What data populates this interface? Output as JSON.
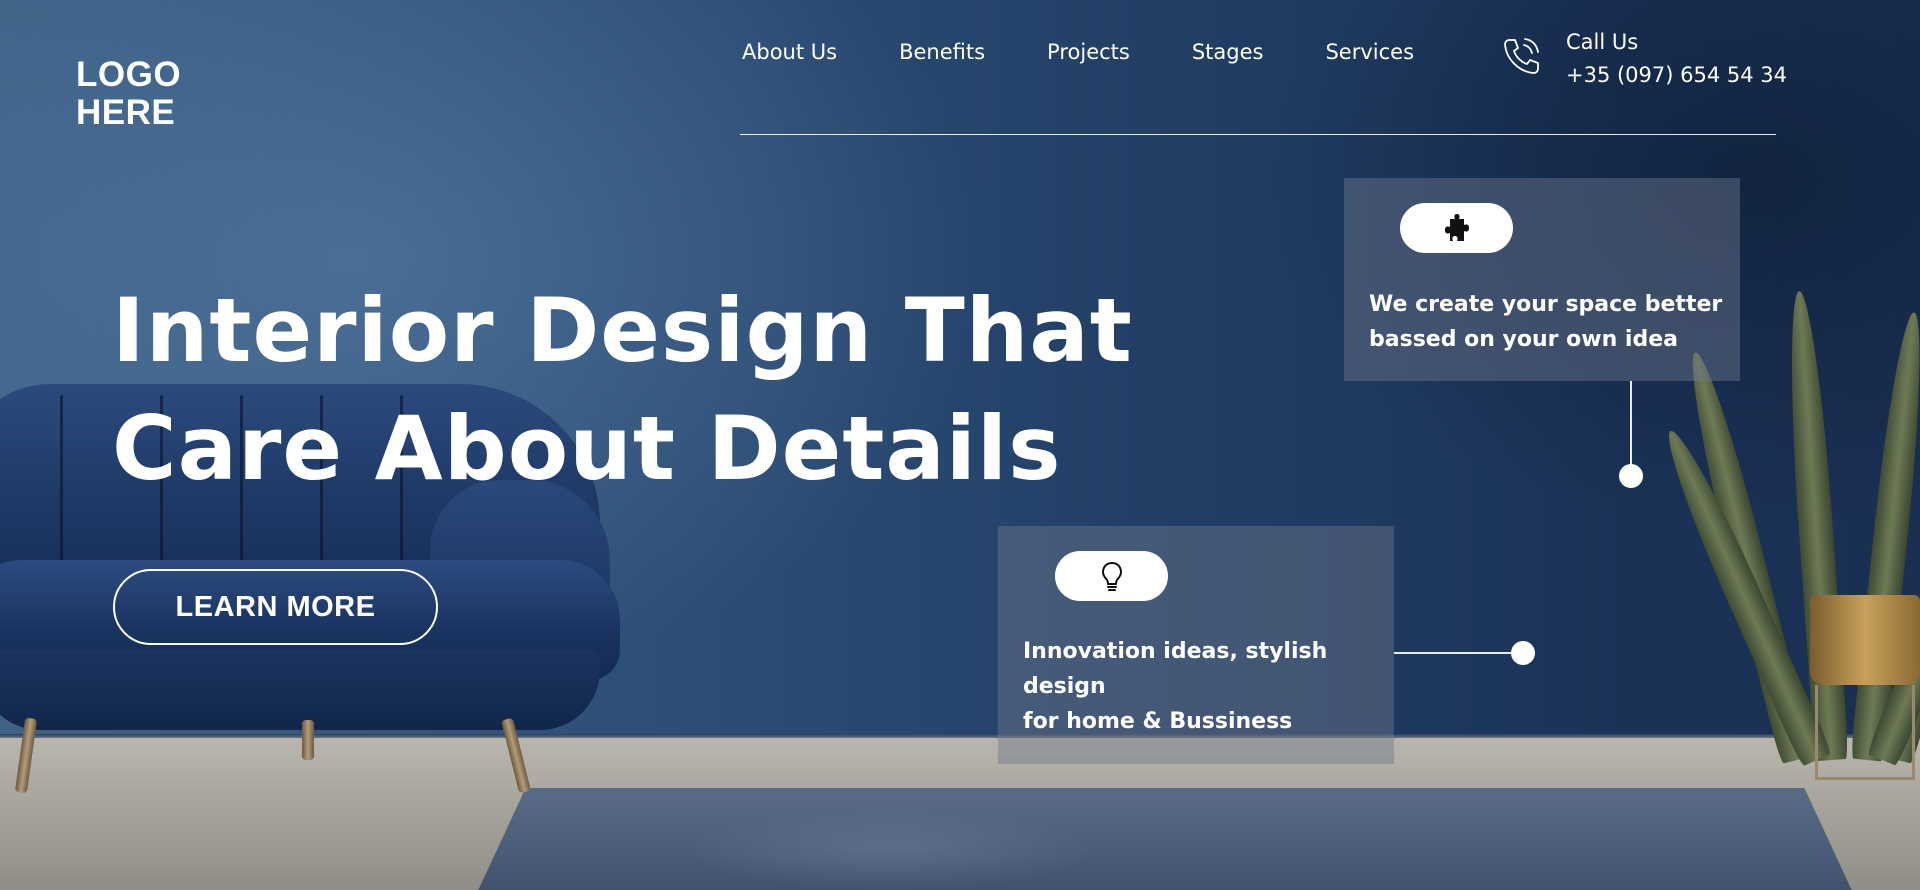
{
  "logo": {
    "line1": "LOGO",
    "line2": "HERE"
  },
  "nav": {
    "items": [
      {
        "label": "About Us"
      },
      {
        "label": "Benefits"
      },
      {
        "label": "Projects"
      },
      {
        "label": "Stages"
      },
      {
        "label": "Services"
      }
    ]
  },
  "contact": {
    "label": "Call Us",
    "phone": "+35 (097) 654 54 34",
    "icon": "phone-icon"
  },
  "hero": {
    "title_line1": "Interior Design That",
    "title_line2": "Care About Details",
    "cta_label": "LEARN MORE"
  },
  "cards": [
    {
      "icon": "puzzle-icon",
      "lines": [
        "We create your space better",
        "bassed on your own idea"
      ]
    },
    {
      "icon": "lightbulb-icon",
      "lines": [
        "Innovation ideas, stylish",
        "design",
        "for home & Bussiness"
      ]
    }
  ],
  "colors": {
    "text": "#ffffff",
    "wall": "#2f5179",
    "card_overlay": "#6e788c"
  }
}
